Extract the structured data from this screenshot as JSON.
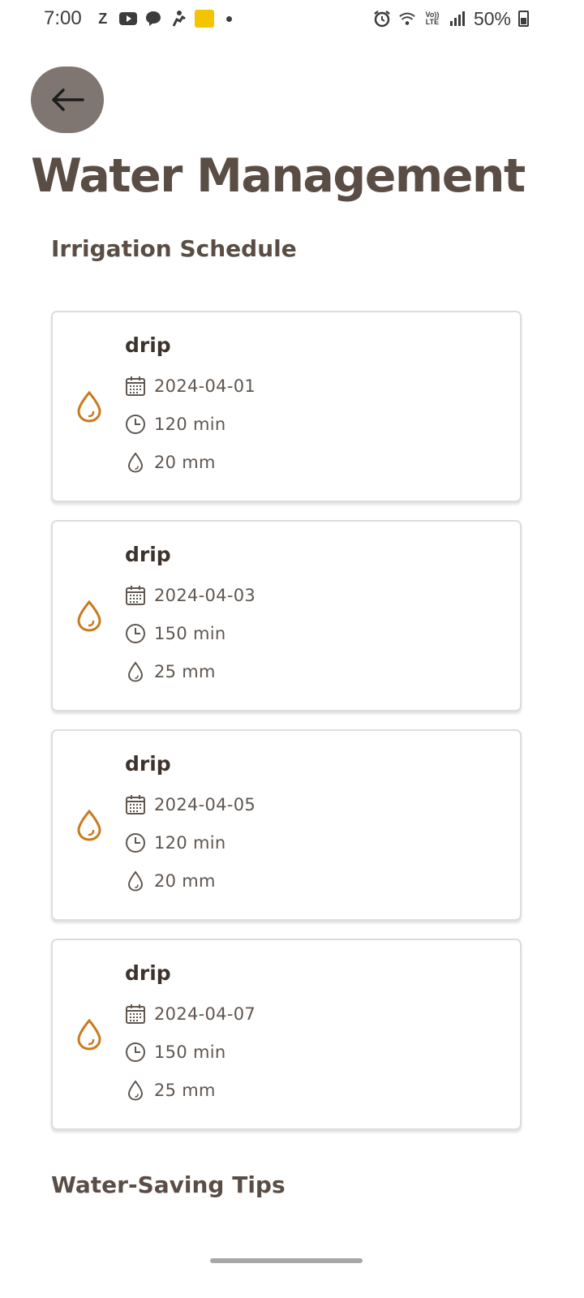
{
  "status_bar": {
    "time": "7:00",
    "z_label": "Z",
    "battery": "50%",
    "icons": [
      "youtube-icon",
      "messenger-icon",
      "fitness-icon",
      "app-badge-icon",
      "alarm-icon",
      "wifi-icon",
      "volte-icon",
      "signal-icon",
      "battery-icon"
    ]
  },
  "header": {
    "title": "Water Management"
  },
  "irrigation": {
    "title": "Irrigation Schedule",
    "items": [
      {
        "method": "drip",
        "date": "2024-04-01",
        "duration": "120 min",
        "amount": "20 mm"
      },
      {
        "method": "drip",
        "date": "2024-04-03",
        "duration": "150 min",
        "amount": "25 mm"
      },
      {
        "method": "drip",
        "date": "2024-04-05",
        "duration": "120 min",
        "amount": "20 mm"
      },
      {
        "method": "drip",
        "date": "2024-04-07",
        "duration": "150 min",
        "amount": "25 mm"
      }
    ]
  },
  "tips": {
    "title": "Water-Saving Tips"
  },
  "colors": {
    "accent": "#c97a1e",
    "title": "#5a4d45",
    "back_button": "#7f7672"
  }
}
